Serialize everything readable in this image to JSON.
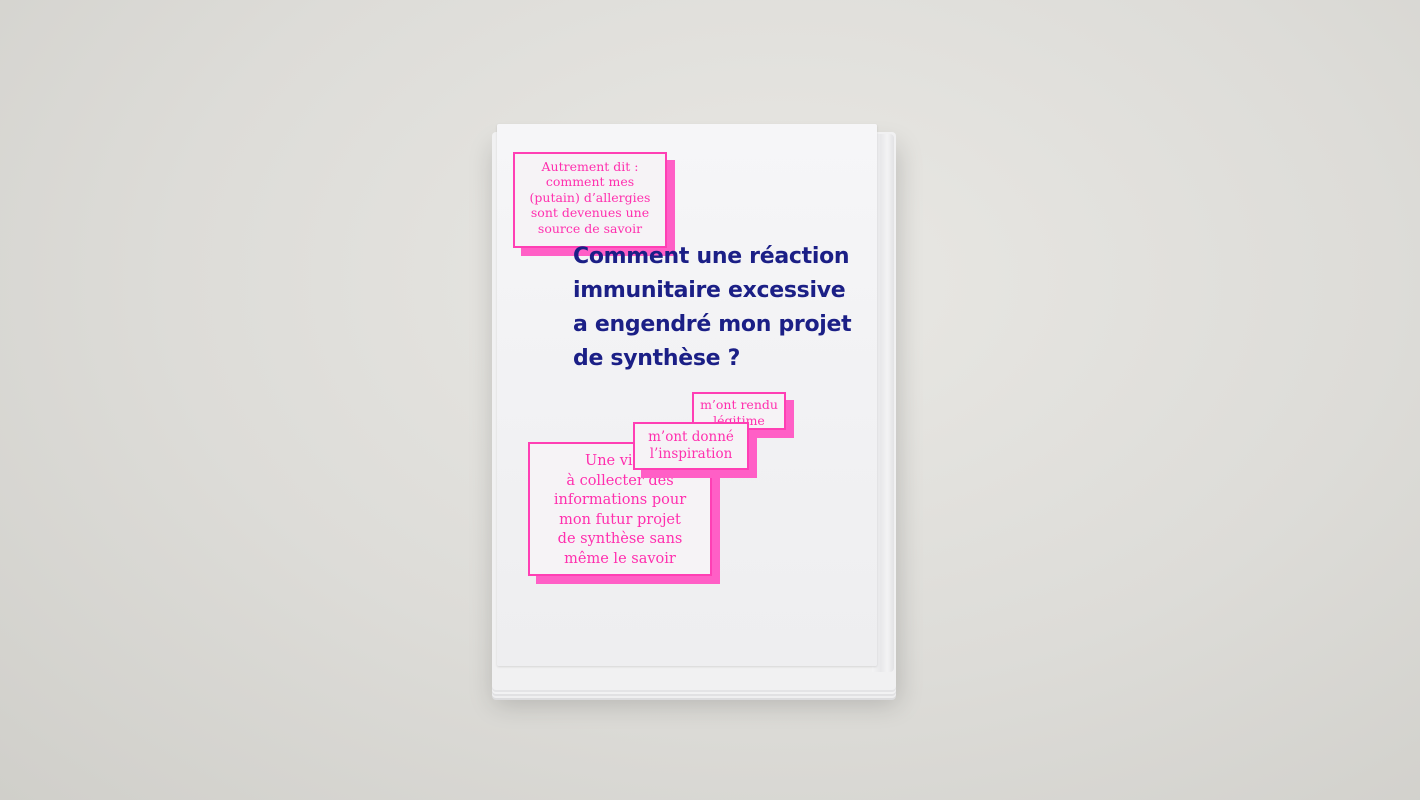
{
  "booklet": {
    "title_lines": [
      "Comment une réaction",
      "immunitaire excessive",
      "a engendré mon projet",
      "de synthèse ?"
    ],
    "tags": {
      "autrement": [
        "Autrement dit :",
        "comment mes",
        "(putain) d’allergies",
        "sont devenues une",
        "source de savoir"
      ],
      "rendu": [
        "m’ont rendu",
        "légitime"
      ],
      "donne": [
        "m’ont donné",
        "l’inspiration"
      ],
      "vie": [
        "Une vie p",
        "à collecter des",
        "informations pour",
        "mon futur projet",
        "de synthèse sans",
        "même le savoir"
      ]
    },
    "colors": {
      "title_ink": "#1b1f86",
      "pink_ink": "#ff2fae",
      "background": "#dddcd8"
    }
  }
}
